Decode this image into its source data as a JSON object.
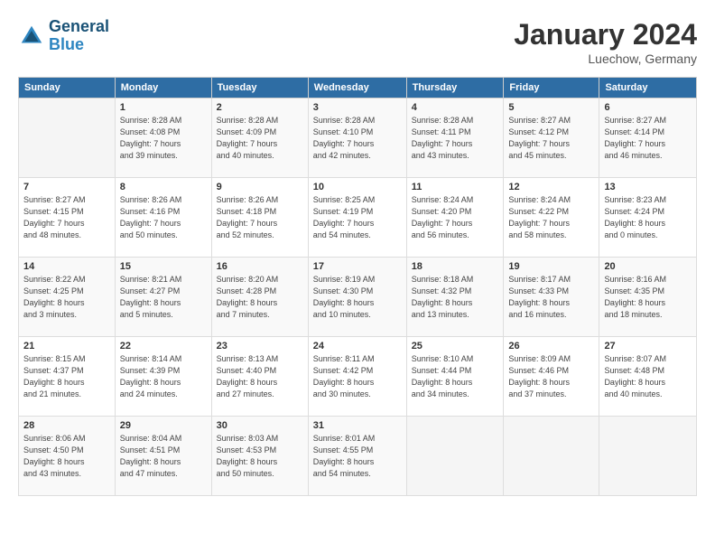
{
  "header": {
    "logo_general": "General",
    "logo_blue": "Blue",
    "month_title": "January 2024",
    "location": "Luechow, Germany"
  },
  "weekdays": [
    "Sunday",
    "Monday",
    "Tuesday",
    "Wednesday",
    "Thursday",
    "Friday",
    "Saturday"
  ],
  "weeks": [
    [
      {
        "day": "",
        "info": ""
      },
      {
        "day": "1",
        "info": "Sunrise: 8:28 AM\nSunset: 4:08 PM\nDaylight: 7 hours\nand 39 minutes."
      },
      {
        "day": "2",
        "info": "Sunrise: 8:28 AM\nSunset: 4:09 PM\nDaylight: 7 hours\nand 40 minutes."
      },
      {
        "day": "3",
        "info": "Sunrise: 8:28 AM\nSunset: 4:10 PM\nDaylight: 7 hours\nand 42 minutes."
      },
      {
        "day": "4",
        "info": "Sunrise: 8:28 AM\nSunset: 4:11 PM\nDaylight: 7 hours\nand 43 minutes."
      },
      {
        "day": "5",
        "info": "Sunrise: 8:27 AM\nSunset: 4:12 PM\nDaylight: 7 hours\nand 45 minutes."
      },
      {
        "day": "6",
        "info": "Sunrise: 8:27 AM\nSunset: 4:14 PM\nDaylight: 7 hours\nand 46 minutes."
      }
    ],
    [
      {
        "day": "7",
        "info": "Sunrise: 8:27 AM\nSunset: 4:15 PM\nDaylight: 7 hours\nand 48 minutes."
      },
      {
        "day": "8",
        "info": "Sunrise: 8:26 AM\nSunset: 4:16 PM\nDaylight: 7 hours\nand 50 minutes."
      },
      {
        "day": "9",
        "info": "Sunrise: 8:26 AM\nSunset: 4:18 PM\nDaylight: 7 hours\nand 52 minutes."
      },
      {
        "day": "10",
        "info": "Sunrise: 8:25 AM\nSunset: 4:19 PM\nDaylight: 7 hours\nand 54 minutes."
      },
      {
        "day": "11",
        "info": "Sunrise: 8:24 AM\nSunset: 4:20 PM\nDaylight: 7 hours\nand 56 minutes."
      },
      {
        "day": "12",
        "info": "Sunrise: 8:24 AM\nSunset: 4:22 PM\nDaylight: 7 hours\nand 58 minutes."
      },
      {
        "day": "13",
        "info": "Sunrise: 8:23 AM\nSunset: 4:24 PM\nDaylight: 8 hours\nand 0 minutes."
      }
    ],
    [
      {
        "day": "14",
        "info": "Sunrise: 8:22 AM\nSunset: 4:25 PM\nDaylight: 8 hours\nand 3 minutes."
      },
      {
        "day": "15",
        "info": "Sunrise: 8:21 AM\nSunset: 4:27 PM\nDaylight: 8 hours\nand 5 minutes."
      },
      {
        "day": "16",
        "info": "Sunrise: 8:20 AM\nSunset: 4:28 PM\nDaylight: 8 hours\nand 7 minutes."
      },
      {
        "day": "17",
        "info": "Sunrise: 8:19 AM\nSunset: 4:30 PM\nDaylight: 8 hours\nand 10 minutes."
      },
      {
        "day": "18",
        "info": "Sunrise: 8:18 AM\nSunset: 4:32 PM\nDaylight: 8 hours\nand 13 minutes."
      },
      {
        "day": "19",
        "info": "Sunrise: 8:17 AM\nSunset: 4:33 PM\nDaylight: 8 hours\nand 16 minutes."
      },
      {
        "day": "20",
        "info": "Sunrise: 8:16 AM\nSunset: 4:35 PM\nDaylight: 8 hours\nand 18 minutes."
      }
    ],
    [
      {
        "day": "21",
        "info": "Sunrise: 8:15 AM\nSunset: 4:37 PM\nDaylight: 8 hours\nand 21 minutes."
      },
      {
        "day": "22",
        "info": "Sunrise: 8:14 AM\nSunset: 4:39 PM\nDaylight: 8 hours\nand 24 minutes."
      },
      {
        "day": "23",
        "info": "Sunrise: 8:13 AM\nSunset: 4:40 PM\nDaylight: 8 hours\nand 27 minutes."
      },
      {
        "day": "24",
        "info": "Sunrise: 8:11 AM\nSunset: 4:42 PM\nDaylight: 8 hours\nand 30 minutes."
      },
      {
        "day": "25",
        "info": "Sunrise: 8:10 AM\nSunset: 4:44 PM\nDaylight: 8 hours\nand 34 minutes."
      },
      {
        "day": "26",
        "info": "Sunrise: 8:09 AM\nSunset: 4:46 PM\nDaylight: 8 hours\nand 37 minutes."
      },
      {
        "day": "27",
        "info": "Sunrise: 8:07 AM\nSunset: 4:48 PM\nDaylight: 8 hours\nand 40 minutes."
      }
    ],
    [
      {
        "day": "28",
        "info": "Sunrise: 8:06 AM\nSunset: 4:50 PM\nDaylight: 8 hours\nand 43 minutes."
      },
      {
        "day": "29",
        "info": "Sunrise: 8:04 AM\nSunset: 4:51 PM\nDaylight: 8 hours\nand 47 minutes."
      },
      {
        "day": "30",
        "info": "Sunrise: 8:03 AM\nSunset: 4:53 PM\nDaylight: 8 hours\nand 50 minutes."
      },
      {
        "day": "31",
        "info": "Sunrise: 8:01 AM\nSunset: 4:55 PM\nDaylight: 8 hours\nand 54 minutes."
      },
      {
        "day": "",
        "info": ""
      },
      {
        "day": "",
        "info": ""
      },
      {
        "day": "",
        "info": ""
      }
    ]
  ]
}
